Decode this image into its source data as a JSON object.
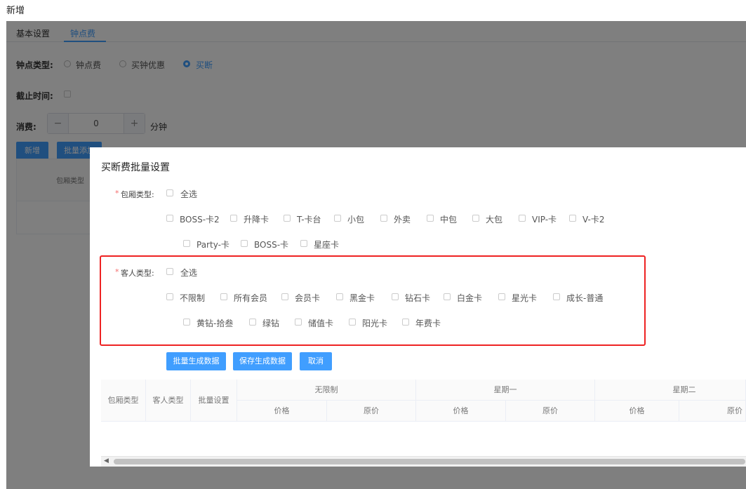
{
  "page_title": "新增",
  "tabs": [
    {
      "label": "基本设置"
    },
    {
      "label": "钟点费"
    }
  ],
  "clock_type": {
    "label": "钟点类型:",
    "options": [
      "钟点费",
      "买钟优惠",
      "买断"
    ],
    "selected": "买断"
  },
  "deadline": {
    "label": "截止时间:"
  },
  "consume": {
    "label": "消费:",
    "value": "0",
    "minus": "−",
    "plus": "+",
    "unit": "分钟"
  },
  "bg_buttons": {
    "add": "新增",
    "batch": "批量添加"
  },
  "bg_table": {
    "header": "包厢类型"
  },
  "dialog": {
    "title": "买断费批量设置",
    "room": {
      "label": "包厢类型:",
      "required_mark": "*",
      "select_all": "全选",
      "row1": [
        "BOSS-卡2",
        "升降卡",
        "T-卡台",
        "小包",
        "外卖",
        "中包",
        "大包",
        "VIP-卡",
        "V-卡2"
      ],
      "row2": [
        "Party-卡",
        "BOSS-卡",
        "星座卡"
      ]
    },
    "guest": {
      "label": "客人类型:",
      "required_mark": "*",
      "select_all": "全选",
      "row1": [
        "不限制",
        "所有会员",
        "会员卡",
        "黑金卡",
        "钻石卡",
        "白金卡",
        "星光卡",
        "成长-普通"
      ],
      "row2": [
        "黄钻-拾叁",
        "绿钻",
        "储值卡",
        "阳光卡",
        "年费卡"
      ]
    },
    "buttons": {
      "generate": "批量生成数据",
      "save": "保存生成数据",
      "cancel": "取消"
    },
    "table": {
      "fixed_headers": [
        "包厢类型",
        "客人类型",
        "批量设置"
      ],
      "groups": [
        "无限制",
        "星期一",
        "星期二"
      ],
      "sub_headers": [
        "价格",
        "原价"
      ]
    },
    "scroll_left": "◀"
  }
}
